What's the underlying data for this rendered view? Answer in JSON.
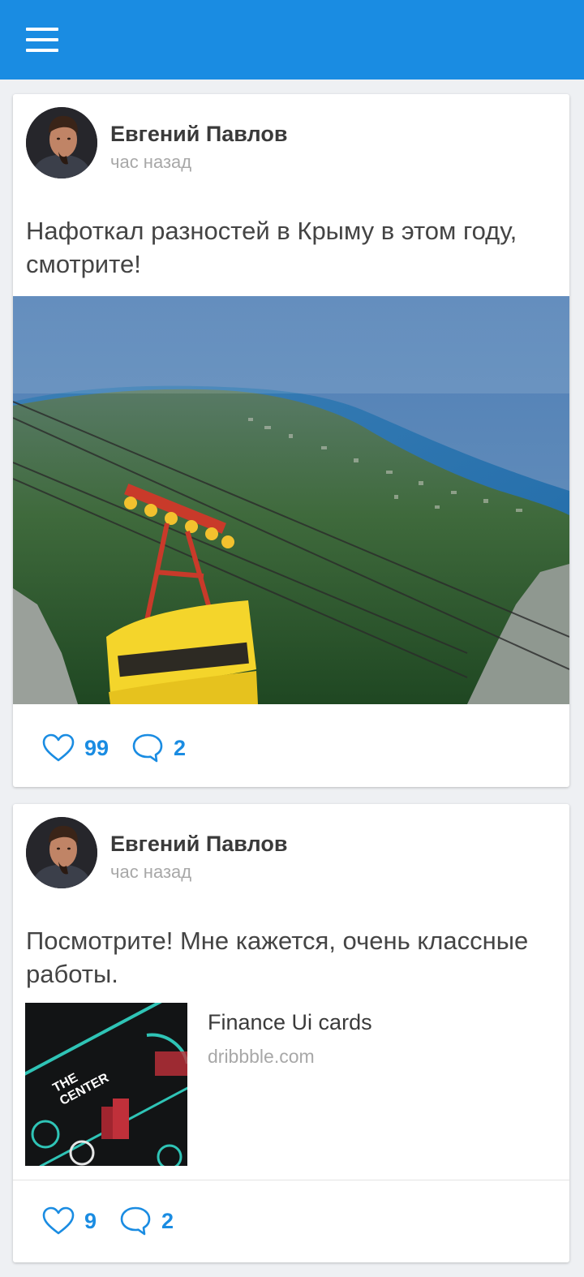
{
  "app": {
    "accent_color": "#1a8ce2",
    "menu_icon": "hamburger-menu-icon"
  },
  "posts": [
    {
      "author": "Евгений Павлов",
      "time": "час назад",
      "text": "Нафоткал разностей в Крыму в этом году, смотрите!",
      "likes": "99",
      "comments": "2"
    },
    {
      "author": "Евгений Павлов",
      "time": "час назад",
      "text": "Посмотрите! Мне кажется, очень классные работы.",
      "link": {
        "title": "Finance Ui cards",
        "domain": "dribbble.com",
        "thumb_text": {
          "line1": "THE",
          "line2": "CENTER"
        }
      },
      "likes": "9",
      "comments": "2"
    }
  ]
}
